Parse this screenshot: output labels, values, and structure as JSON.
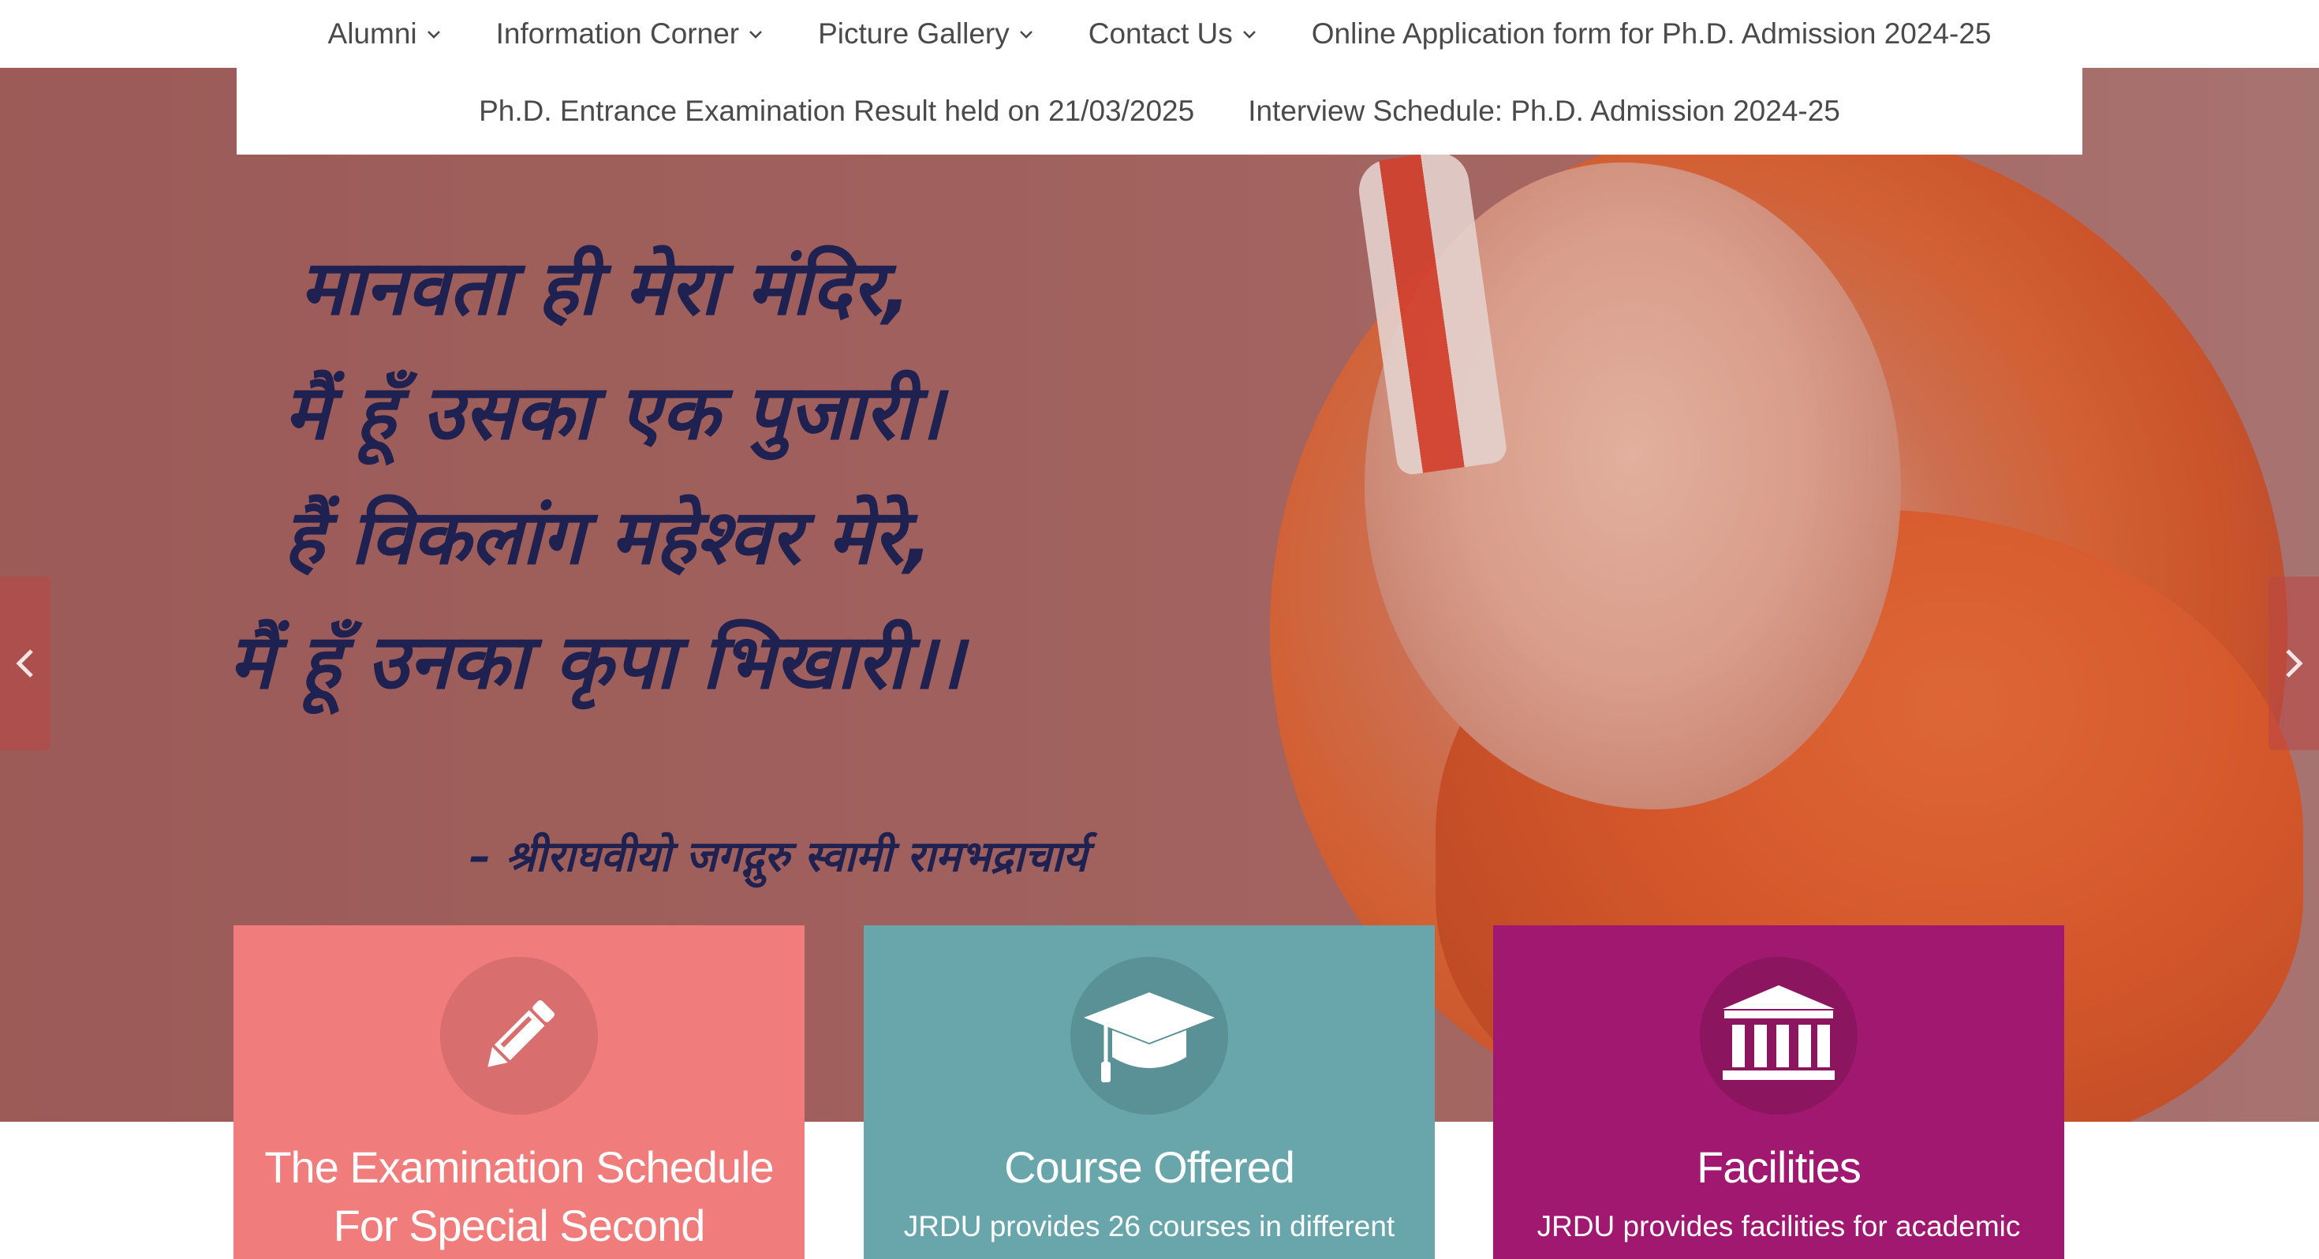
{
  "nav": {
    "row1": [
      {
        "label": "Alumni",
        "has_dropdown": true
      },
      {
        "label": "Information Corner",
        "has_dropdown": true
      },
      {
        "label": "Picture Gallery",
        "has_dropdown": true
      },
      {
        "label": "Contact Us",
        "has_dropdown": true
      },
      {
        "label": "Online Application form for Ph.D. Admission 2024-25",
        "has_dropdown": false
      }
    ],
    "row2": [
      {
        "label": "Ph.D. Entrance Examination Result held on 21/03/2025"
      },
      {
        "label": "Interview Schedule: Ph.D. Admission 2024-25"
      }
    ]
  },
  "hero": {
    "quote_lines": [
      "मानवता ही मेरा मंदिर,",
      "मैं हूँ उसका एक पुजारी।",
      "हैं विकलांग महेश्वर मेरे,",
      "मैं हूँ उनका कृपा भिखारी।।"
    ],
    "attribution": "– श्रीराघवीयो जगद्गुरु स्वामी रामभद्राचार्य",
    "prev_icon": "chevron-left-icon",
    "next_icon": "chevron-right-icon"
  },
  "cards": [
    {
      "id": "exam",
      "icon": "pencil-icon",
      "title_lines": [
        "The Examination Schedule",
        "For Special Second"
      ],
      "desc": "",
      "color": "#f07c7c"
    },
    {
      "id": "course",
      "icon": "graduation-cap-icon",
      "title_lines": [
        "Course Offered"
      ],
      "desc": "JRDU provides 26 courses in different",
      "color": "#69a6ab"
    },
    {
      "id": "facility",
      "icon": "institution-icon",
      "title_lines": [
        "Facilities"
      ],
      "desc": "JRDU provides facilities for academic",
      "color": "#a0186f"
    }
  ],
  "colors": {
    "nav_text": "#4a4a4a",
    "hero_overlay": "#9b5b58",
    "quote_text": "#1f2150"
  }
}
